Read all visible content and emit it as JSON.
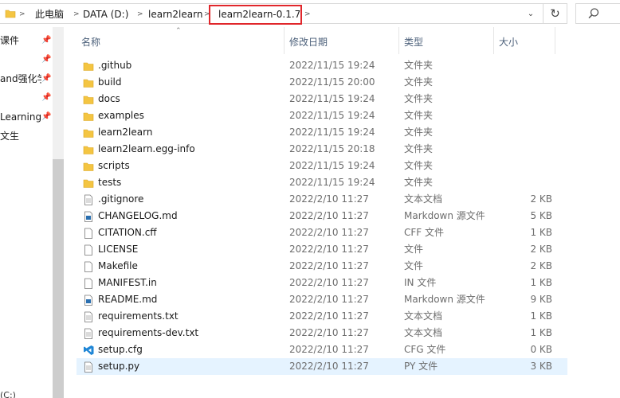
{
  "address_bar": {
    "breadcrumbs": [
      "此电脑",
      "DATA (D:)",
      "learn2learn"
    ],
    "current": "learn2learn-0.1.7",
    "highlight_color": "#e0262b"
  },
  "nav": {
    "items": [
      "课件",
      "",
      "and强化学",
      "",
      "Learning",
      "文生"
    ],
    "bottom_label": "(C:)"
  },
  "columns": {
    "name": "名称",
    "date": "修改日期",
    "type": "类型",
    "size": "大小"
  },
  "files": [
    {
      "name": ".github",
      "date": "2022/11/15 19:24",
      "type": "文件夹",
      "size": "",
      "icon": "folder-icon"
    },
    {
      "name": "build",
      "date": "2022/11/15 20:00",
      "type": "文件夹",
      "size": "",
      "icon": "folder-icon"
    },
    {
      "name": "docs",
      "date": "2022/11/15 19:24",
      "type": "文件夹",
      "size": "",
      "icon": "folder-icon"
    },
    {
      "name": "examples",
      "date": "2022/11/15 19:24",
      "type": "文件夹",
      "size": "",
      "icon": "folder-icon"
    },
    {
      "name": "learn2learn",
      "date": "2022/11/15 19:24",
      "type": "文件夹",
      "size": "",
      "icon": "folder-icon"
    },
    {
      "name": "learn2learn.egg-info",
      "date": "2022/11/15 20:18",
      "type": "文件夹",
      "size": "",
      "icon": "folder-icon"
    },
    {
      "name": "scripts",
      "date": "2022/11/15 19:24",
      "type": "文件夹",
      "size": "",
      "icon": "folder-icon"
    },
    {
      "name": "tests",
      "date": "2022/11/15 19:24",
      "type": "文件夹",
      "size": "",
      "icon": "folder-icon"
    },
    {
      "name": ".gitignore",
      "date": "2022/2/10 11:27",
      "type": "文本文档",
      "size": "2 KB",
      "icon": "text-file-icon"
    },
    {
      "name": "CHANGELOG.md",
      "date": "2022/2/10 11:27",
      "type": "Markdown 源文件",
      "size": "5 KB",
      "icon": "markdown-file-icon"
    },
    {
      "name": "CITATION.cff",
      "date": "2022/2/10 11:27",
      "type": "CFF 文件",
      "size": "1 KB",
      "icon": "file-icon"
    },
    {
      "name": "LICENSE",
      "date": "2022/2/10 11:27",
      "type": "文件",
      "size": "2 KB",
      "icon": "file-icon"
    },
    {
      "name": "Makefile",
      "date": "2022/2/10 11:27",
      "type": "文件",
      "size": "2 KB",
      "icon": "file-icon"
    },
    {
      "name": "MANIFEST.in",
      "date": "2022/2/10 11:27",
      "type": "IN 文件",
      "size": "1 KB",
      "icon": "file-icon"
    },
    {
      "name": "README.md",
      "date": "2022/2/10 11:27",
      "type": "Markdown 源文件",
      "size": "9 KB",
      "icon": "markdown-file-icon"
    },
    {
      "name": "requirements.txt",
      "date": "2022/2/10 11:27",
      "type": "文本文档",
      "size": "1 KB",
      "icon": "text-file-icon"
    },
    {
      "name": "requirements-dev.txt",
      "date": "2022/2/10 11:27",
      "type": "文本文档",
      "size": "1 KB",
      "icon": "text-file-icon"
    },
    {
      "name": "setup.cfg",
      "date": "2022/2/10 11:27",
      "type": "CFG 文件",
      "size": "0 KB",
      "icon": "vscode-file-icon"
    },
    {
      "name": "setup.py",
      "date": "2022/2/10 11:27",
      "type": "PY 文件",
      "size": "3 KB",
      "icon": "text-file-icon",
      "selected": true
    }
  ],
  "colors": {
    "folder": "#f4c542",
    "selected_row": "#e5f3ff",
    "vscode": "#1f86d6"
  }
}
